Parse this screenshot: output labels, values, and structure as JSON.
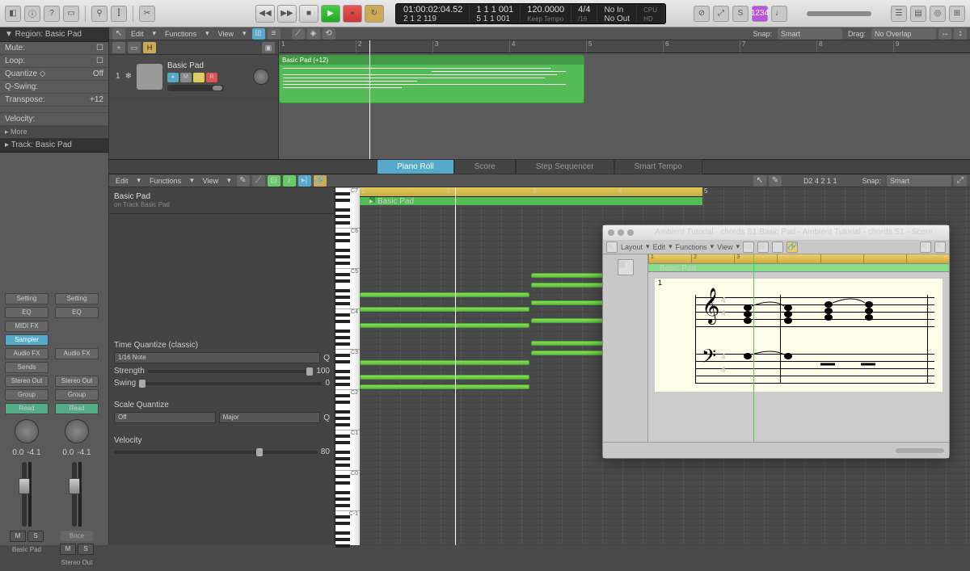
{
  "toolbar": {
    "lcd": {
      "time": "01:00:02:04.52",
      "time2": "2 1 2 119",
      "bars": "1 1 1 001",
      "bars2": "5 1 1 001",
      "tempo": "120.0000",
      "tempo_mode": "Keep Tempo",
      "sig": "4/4",
      "division": "/16",
      "noin": "No In",
      "noout": "No Out",
      "cpu": "CPU",
      "hd": "HD"
    }
  },
  "inspector": {
    "region_hdr": "▼ Region: Basic Pad",
    "mute": "Mute:",
    "loop": "Loop:",
    "quantize": "Quantize ◇",
    "quantize_val": "Off",
    "qswing": "Q-Swing:",
    "transpose": "Transpose:",
    "transpose_val": "+12",
    "velocity": "Velocity:",
    "more": "▸ More",
    "track_hdr": "▸ Track: Basic Pad",
    "setting": "Setting",
    "eq": "EQ",
    "midifx": "MIDI FX",
    "sampler": "Sampler",
    "audiofx": "Audio FX",
    "sends": "Sends",
    "stereoout": "Stereo Out",
    "group": "Group",
    "read": "Read",
    "pan1": "0.0",
    "vol1": "-4.1",
    "pan2": "0.0",
    "vol2": "-4.1",
    "m": "M",
    "s": "S",
    "name1": "Basic Pad",
    "name2": "Stereo Out",
    "bnce": "Bnce"
  },
  "menu": {
    "edit": "Edit",
    "functions": "Functions",
    "view": "View",
    "snap": "Snap:",
    "snap_val": "Smart",
    "drag": "Drag:",
    "drag_val": "No Overlap"
  },
  "track": {
    "h": "H",
    "plus": "+",
    "name": "Basic Pad",
    "region_label": "Basic Pad (+12)",
    "num": "1"
  },
  "ruler": {
    "m1": "1",
    "m2": "2",
    "m3": "3",
    "m4": "4",
    "m5": "5",
    "m6": "6",
    "m7": "7",
    "m8": "8",
    "m9": "9"
  },
  "tabs": {
    "piano": "Piano Roll",
    "score": "Score",
    "step": "Step Sequencer",
    "smart": "Smart Tempo"
  },
  "piano": {
    "name": "Basic Pad",
    "sub": "on Track Basic Pad",
    "tq": "Time Quantize (classic)",
    "tq_val": "1/16 Note",
    "strength": "Strength",
    "strength_val": "100",
    "swing": "Swing",
    "swing_val": "0",
    "sq": "Scale Quantize",
    "sq_off": "Off",
    "sq_scale": "Major",
    "vel": "Velocity",
    "vel_val": "80",
    "q": "Q",
    "info": "D2  4 2 1 1",
    "snap": "Snap:",
    "snap_val": "Smart",
    "region_label": "Basic Pad"
  },
  "score": {
    "title": "Ambient Tutorial - chords S1:Basic Pad - Ambient Tutorial - chords S1 - Score",
    "layout": "Layout",
    "edit": "Edit",
    "functions": "Functions",
    "view": "View",
    "region_label": "Basic Pad",
    "timesig_num": "4",
    "timesig_den": "4",
    "measure_num": "1"
  }
}
